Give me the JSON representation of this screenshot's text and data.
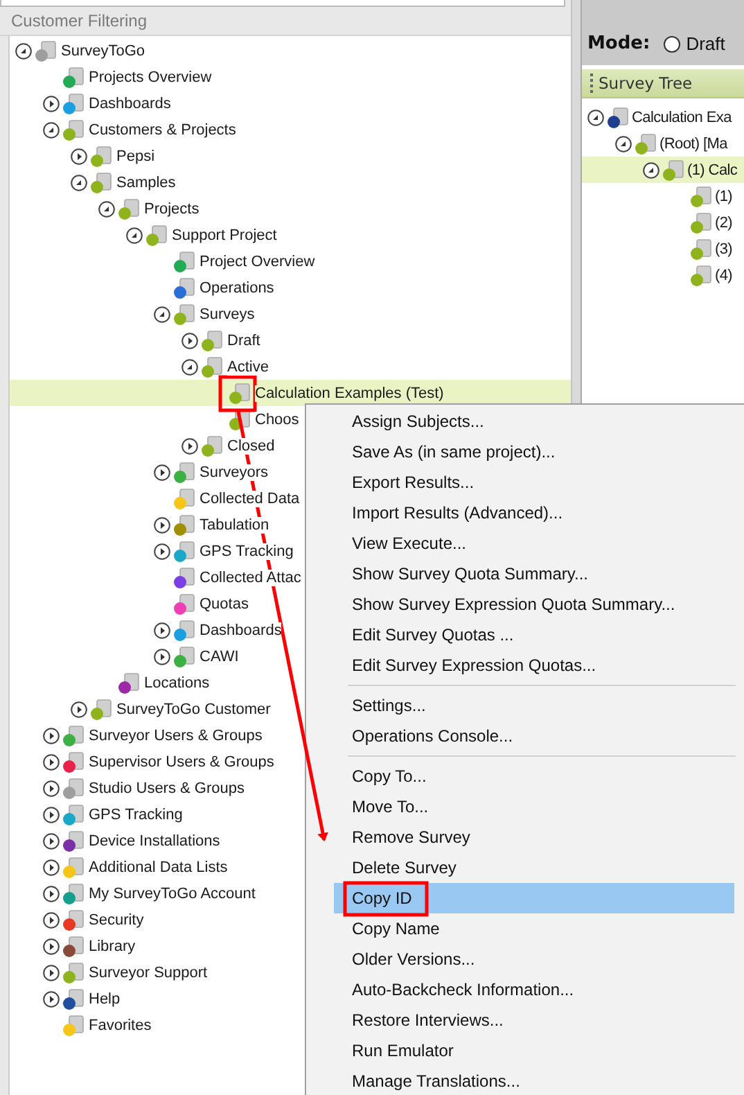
{
  "left_panel": {
    "title": "Customer Filtering",
    "tree": [
      {
        "label": "SurveyToGo",
        "expanded": true,
        "selected": false,
        "color": "#9e9e9e",
        "children": [
          {
            "label": "Projects Overview",
            "selected": false,
            "color": "#22aa55"
          },
          {
            "label": "Dashboards",
            "expanded": false,
            "selected": false,
            "color": "#1a9fe0"
          },
          {
            "label": "Customers & Projects",
            "expanded": true,
            "selected": false,
            "color": "#8fb31c",
            "children": [
              {
                "label": "Pepsi",
                "expanded": false,
                "selected": false,
                "color": "#8fb31c"
              },
              {
                "label": "Samples",
                "expanded": true,
                "selected": false,
                "color": "#8fb31c",
                "children": [
                  {
                    "label": "Projects",
                    "expanded": true,
                    "selected": false,
                    "color": "#8fb31c",
                    "children": [
                      {
                        "label": "Support Project",
                        "expanded": true,
                        "selected": false,
                        "color": "#8fb31c",
                        "children": [
                          {
                            "label": "Project Overview",
                            "selected": false,
                            "color": "#22aa55"
                          },
                          {
                            "label": "Operations",
                            "selected": false,
                            "color": "#2a6fd6"
                          },
                          {
                            "label": "Surveys",
                            "expanded": true,
                            "selected": false,
                            "color": "#8fb31c",
                            "children": [
                              {
                                "label": "Draft",
                                "expanded": false,
                                "selected": false,
                                "color": "#8fb31c"
                              },
                              {
                                "label": "Active",
                                "expanded": true,
                                "selected": false,
                                "color": "#8fb31c",
                                "children": [
                                  {
                                    "label": "Calculation Examples (Test)",
                                    "selected": true,
                                    "color": "#8fb31c"
                                  },
                                  {
                                    "label": "Choos",
                                    "selected": false,
                                    "color": "#8fb31c"
                                  }
                                ]
                              },
                              {
                                "label": "Closed",
                                "expanded": false,
                                "selected": false,
                                "color": "#8fb31c"
                              }
                            ]
                          },
                          {
                            "label": "Surveyors",
                            "expanded": false,
                            "selected": false,
                            "color": "#3cb043"
                          },
                          {
                            "label": "Collected Data",
                            "selected": false,
                            "color": "#f5c518"
                          },
                          {
                            "label": "Tabulation",
                            "expanded": false,
                            "selected": false,
                            "color": "#a09000"
                          },
                          {
                            "label": "GPS Tracking",
                            "expanded": false,
                            "selected": false,
                            "color": "#1aa7c8"
                          },
                          {
                            "label": "Collected Attac",
                            "selected": false,
                            "color": "#7b3fe4"
                          },
                          {
                            "label": "Quotas",
                            "selected": false,
                            "color": "#ee3fb5"
                          },
                          {
                            "label": "Dashboards",
                            "expanded": false,
                            "selected": false,
                            "color": "#1a9fe0"
                          },
                          {
                            "label": "CAWI",
                            "expanded": false,
                            "selected": false,
                            "color": "#3cb043"
                          }
                        ]
                      }
                    ]
                  },
                  {
                    "label": "Locations",
                    "selected": false,
                    "color": "#9c2aa6"
                  }
                ]
              },
              {
                "label": "SurveyToGo Customer",
                "expanded": false,
                "selected": false,
                "color": "#8fb31c"
              }
            ]
          },
          {
            "label": "Surveyor Users & Groups",
            "expanded": false,
            "selected": false,
            "color": "#3cb043"
          },
          {
            "label": "Supervisor Users & Groups",
            "expanded": false,
            "selected": false,
            "color": "#e8224a"
          },
          {
            "label": "Studio Users & Groups",
            "expanded": false,
            "selected": false,
            "color": "#9e9e9e"
          },
          {
            "label": "GPS Tracking",
            "expanded": false,
            "selected": false,
            "color": "#1aa7c8"
          },
          {
            "label": "Device Installations",
            "expanded": false,
            "selected": false,
            "color": "#7b2fa6"
          },
          {
            "label": "Additional Data Lists",
            "expanded": false,
            "selected": false,
            "color": "#f5c518"
          },
          {
            "label": "My SurveyToGo Account",
            "expanded": false,
            "selected": false,
            "color": "#149e8e"
          },
          {
            "label": "Security",
            "expanded": false,
            "selected": false,
            "color": "#e83a22"
          },
          {
            "label": "Library",
            "expanded": false,
            "selected": false,
            "color": "#8a4a3a"
          },
          {
            "label": "Surveyor Support",
            "expanded": false,
            "selected": false,
            "color": "#8fb31c"
          },
          {
            "label": "Help",
            "expanded": false,
            "selected": false,
            "color": "#1f4f9e"
          },
          {
            "label": "Favorites",
            "selected": false,
            "color": "#f5c518"
          }
        ]
      }
    ]
  },
  "right_panel": {
    "mode_label": "Mode:",
    "mode_options": [
      {
        "label": "Draft",
        "selected": false
      }
    ],
    "survey_tree": {
      "title": "Survey Tree",
      "tree": [
        {
          "label": "Calculation Exa",
          "expanded": true,
          "selected": false,
          "color": "#1f3f8f",
          "children": [
            {
              "label": "(Root) [Ma",
              "expanded": true,
              "selected": false,
              "color": "#8fb31c",
              "children": [
                {
                  "label": "(1) Calc",
                  "expanded": true,
                  "selected": true,
                  "color": "#8fb31c",
                  "children": [
                    {
                      "label": "(1)",
                      "selected": false,
                      "color": "#8fb31c"
                    },
                    {
                      "label": "(2)",
                      "selected": false,
                      "color": "#8fb31c"
                    },
                    {
                      "label": "(3)",
                      "selected": false,
                      "color": "#8fb31c"
                    },
                    {
                      "label": "(4)",
                      "selected": false,
                      "color": "#8fb31c"
                    }
                  ]
                }
              ]
            }
          ]
        }
      ]
    }
  },
  "context_menu": {
    "groups": [
      [
        {
          "label": "Assign Subjects...",
          "selected": false
        },
        {
          "label": "Save As (in same project)...",
          "selected": false
        },
        {
          "label": "Export Results...",
          "selected": false
        },
        {
          "label": "Import Results (Advanced)...",
          "selected": false
        },
        {
          "label": "View Execute...",
          "selected": false
        },
        {
          "label": "Show Survey Quota Summary...",
          "selected": false
        },
        {
          "label": "Show Survey Expression Quota Summary...",
          "selected": false
        },
        {
          "label": "Edit Survey Quotas ...",
          "selected": false
        },
        {
          "label": "Edit Survey Expression Quotas...",
          "selected": false
        }
      ],
      [
        {
          "label": "Settings...",
          "selected": false
        },
        {
          "label": "Operations Console...",
          "selected": false
        }
      ],
      [
        {
          "label": "Copy To...",
          "selected": false
        },
        {
          "label": "Move To...",
          "selected": false
        },
        {
          "label": "Remove Survey",
          "selected": false
        },
        {
          "label": "Delete Survey",
          "selected": false
        },
        {
          "label": "Copy ID",
          "selected": true
        },
        {
          "label": "Copy Name",
          "selected": false
        },
        {
          "label": "Older Versions...",
          "selected": false
        },
        {
          "label": "Auto-Backcheck Information...",
          "selected": false
        },
        {
          "label": "Restore Interviews...",
          "selected": false
        },
        {
          "label": "Run Emulator",
          "selected": false
        },
        {
          "label": "Manage Translations...",
          "selected": false
        }
      ]
    ]
  }
}
